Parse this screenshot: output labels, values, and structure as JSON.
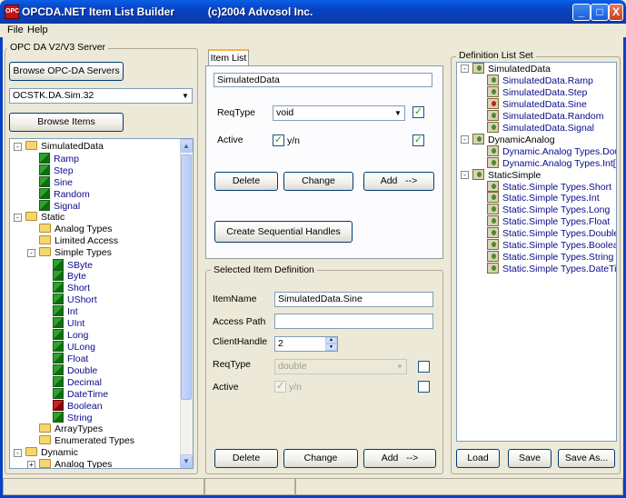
{
  "window": {
    "title": "OPCDA.NET Item List Builder           (c)2004 Advosol Inc.",
    "icon_text": "OPC",
    "buttons": {
      "minimize": "_",
      "maximize": "□",
      "close": "X"
    }
  },
  "menu": {
    "items": [
      "File",
      "Help"
    ]
  },
  "server_group": {
    "title": "OPC DA V2/V3 Server",
    "browse_servers_label": "Browse OPC-DA Servers",
    "server_value": "OCSTK.DA.Sim.32",
    "browse_items_label": "Browse Items"
  },
  "browse_tree": {
    "nodes": [
      {
        "label": "SimulatedData",
        "kind": "folder",
        "level": 0,
        "expander": "-"
      },
      {
        "label": "Ramp",
        "kind": "tag",
        "level": 1
      },
      {
        "label": "Step",
        "kind": "tag",
        "level": 1
      },
      {
        "label": "Sine",
        "kind": "tag",
        "level": 1
      },
      {
        "label": "Random",
        "kind": "tag",
        "level": 1
      },
      {
        "label": "Signal",
        "kind": "tag",
        "level": 1
      },
      {
        "label": "Static",
        "kind": "folder",
        "level": 0,
        "expander": "-"
      },
      {
        "label": "Analog Types",
        "kind": "folder",
        "level": 1
      },
      {
        "label": "Limited Access",
        "kind": "folder",
        "level": 1
      },
      {
        "label": "Simple Types",
        "kind": "folder",
        "level": 1,
        "expander": "-"
      },
      {
        "label": "SByte",
        "kind": "tag",
        "level": 2
      },
      {
        "label": "Byte",
        "kind": "tag",
        "level": 2
      },
      {
        "label": "Short",
        "kind": "tag",
        "level": 2
      },
      {
        "label": "UShort",
        "kind": "tag",
        "level": 2
      },
      {
        "label": "Int",
        "kind": "tag",
        "level": 2
      },
      {
        "label": "UInt",
        "kind": "tag",
        "level": 2
      },
      {
        "label": "Long",
        "kind": "tag",
        "level": 2
      },
      {
        "label": "ULong",
        "kind": "tag",
        "level": 2
      },
      {
        "label": "Float",
        "kind": "tag",
        "level": 2
      },
      {
        "label": "Double",
        "kind": "tag",
        "level": 2
      },
      {
        "label": "Decimal",
        "kind": "tag",
        "level": 2
      },
      {
        "label": "DateTime",
        "kind": "tag",
        "level": 2
      },
      {
        "label": "Boolean",
        "kind": "tag-red",
        "level": 2
      },
      {
        "label": "String",
        "kind": "tag",
        "level": 2
      },
      {
        "label": "ArrayTypes",
        "kind": "folder",
        "level": 1
      },
      {
        "label": "Enumerated Types",
        "kind": "folder",
        "level": 1
      },
      {
        "label": "Dynamic",
        "kind": "folder",
        "level": 0,
        "expander": "-"
      },
      {
        "label": "Analog Types",
        "kind": "folder",
        "level": 1,
        "expander": "+"
      }
    ]
  },
  "item_list": {
    "tab_label": "Item List",
    "name_value": "SimulatedData",
    "reqtype_label": "ReqType",
    "reqtype_value": "void",
    "active_label": "Active",
    "active_yn": "y/n",
    "delete_label": "Delete",
    "change_label": "Change",
    "add_label": "Add   -->",
    "sequential_label": "Create Sequential Handles"
  },
  "selected_item": {
    "title": "Selected Item Definition",
    "itemname_label": "ItemName",
    "itemname_value": "SimulatedData.Sine",
    "accesspath_label": "Access Path",
    "accesspath_value": "",
    "clienthandle_label": "ClientHandle",
    "clienthandle_value": "2",
    "reqtype_label": "ReqType",
    "reqtype_value": "double",
    "active_label": "Active",
    "active_yn": "y/n",
    "delete_label": "Delete",
    "change_label": "Change",
    "add_label": "Add   -->"
  },
  "definition_set": {
    "title": "Definition List Set",
    "nodes": [
      {
        "label": "SimulatedData",
        "kind": "root",
        "level": 0
      },
      {
        "label": "SimulatedData.Ramp",
        "kind": "item",
        "level": 1
      },
      {
        "label": "SimulatedData.Step",
        "kind": "item",
        "level": 1
      },
      {
        "label": "SimulatedData.Sine",
        "kind": "item-red",
        "level": 1
      },
      {
        "label": "SimulatedData.Random",
        "kind": "item",
        "level": 1
      },
      {
        "label": "SimulatedData.Signal",
        "kind": "item",
        "level": 1
      },
      {
        "label": "DynamicAnalog",
        "kind": "root",
        "level": 0
      },
      {
        "label": "Dynamic.Analog Types.Double",
        "kind": "item",
        "level": 1
      },
      {
        "label": "Dynamic.Analog Types.Int[]",
        "kind": "item",
        "level": 1
      },
      {
        "label": "StaticSimple",
        "kind": "root",
        "level": 0
      },
      {
        "label": "Static.Simple Types.Short",
        "kind": "item",
        "level": 1
      },
      {
        "label": "Static.Simple Types.Int",
        "kind": "item",
        "level": 1
      },
      {
        "label": "Static.Simple Types.Long",
        "kind": "item",
        "level": 1
      },
      {
        "label": "Static.Simple Types.Float",
        "kind": "item",
        "level": 1
      },
      {
        "label": "Static.Simple Types.Double",
        "kind": "item",
        "level": 1
      },
      {
        "label": "Static.Simple Types.Boolean",
        "kind": "item",
        "level": 1
      },
      {
        "label": "Static.Simple Types.String",
        "kind": "item",
        "level": 1
      },
      {
        "label": "Static.Simple Types.DateTime",
        "kind": "item",
        "level": 1
      }
    ],
    "load_label": "Load",
    "save_label": "Save",
    "save_as_label": "Save As..."
  }
}
